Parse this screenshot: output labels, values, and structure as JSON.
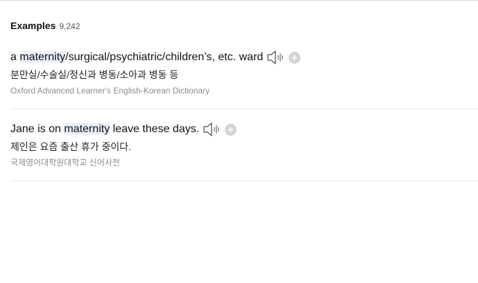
{
  "header": {
    "title": "Examples",
    "count": "9,242"
  },
  "examples": [
    {
      "en_before": "a ",
      "en_keyword": "maternity",
      "en_after": "/surgical/psychiatric/children’s, etc. ward",
      "ko": "분만실/수술실/정신과 병동/소아과 병동 등",
      "source": "Oxford Advanced Learner's English-Korean Dictionary"
    },
    {
      "en_before": "Jane is on ",
      "en_keyword": "maternity",
      "en_after": " leave these days.",
      "ko": "제인은 요즘 출산 휴가 중이다.",
      "source": "국제영어대학원대학교 신어사전"
    }
  ],
  "icons": {
    "speaker": "speaker-icon",
    "add": "plus-icon"
  },
  "colors": {
    "highlight": "#e8f0fb",
    "add_button": "#d2d2d2"
  }
}
